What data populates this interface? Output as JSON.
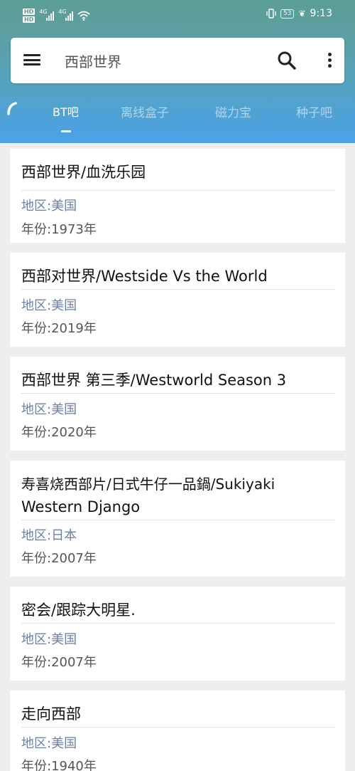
{
  "status_bar": {
    "sim1": "HD",
    "sim2": "HD",
    "net1": "4G",
    "net2": "4G",
    "battery": "53",
    "time": "9:13"
  },
  "search": {
    "title": "西部世界"
  },
  "tabs": [
    "BT吧",
    "离线盒子",
    "磁力宝",
    "种子吧"
  ],
  "results": [
    {
      "title": "西部世界/血洗乐园",
      "region": "地区:美国",
      "year": "年份:1973年"
    },
    {
      "title": "西部对世界/Westside Vs the World",
      "region": "地区:美国",
      "year": "年份:2019年"
    },
    {
      "title": "西部世界 第三季/Westworld Season 3",
      "region": "地区:美国",
      "year": "年份:2020年"
    },
    {
      "title_line1": "寿喜烧西部片/日式牛仔一品鍋/Sukiyaki",
      "title_line2": "Western Django",
      "region": "地区:日本",
      "year": "年份:2007年"
    },
    {
      "title": "密会/跟踪大明星.",
      "region": "地区:美国",
      "year": "年份:2007年"
    },
    {
      "title": "走向西部",
      "region": "地区:美国",
      "year": "年份:1940年"
    }
  ]
}
